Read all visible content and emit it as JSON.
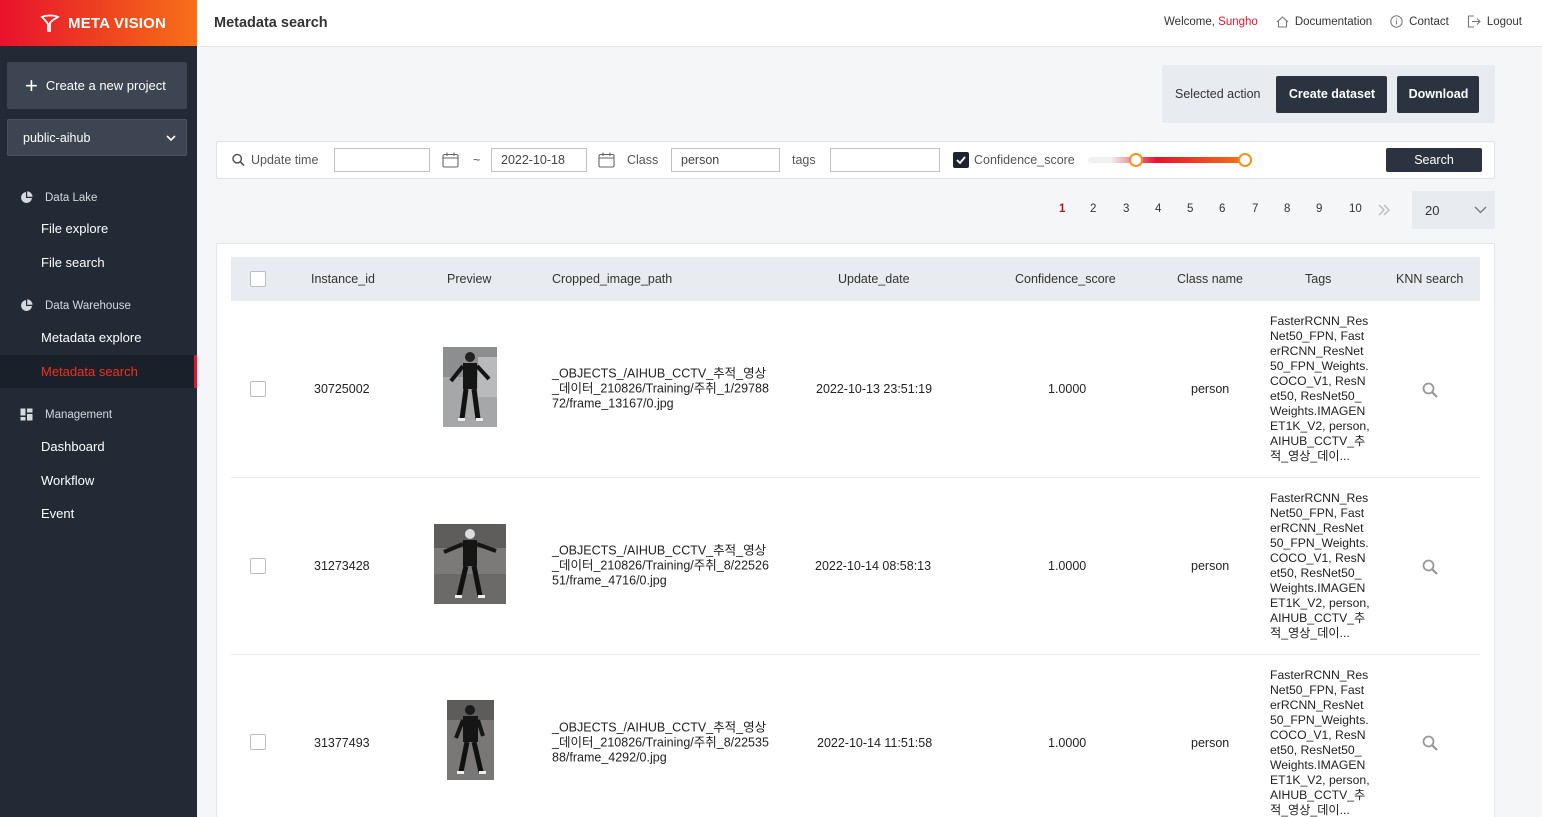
{
  "brand": {
    "name": "META VISION"
  },
  "sidebar": {
    "create_label": "Create a new project",
    "project_select": "public-aihub",
    "sections": [
      {
        "title": "Data Lake",
        "items": [
          "File explore",
          "File search"
        ]
      },
      {
        "title": "Data Warehouse",
        "items": [
          "Metadata explore",
          "Metadata search"
        ]
      },
      {
        "title": "Management",
        "items": [
          "Dashboard",
          "Workflow",
          "Event"
        ]
      }
    ],
    "active_item": "Metadata search"
  },
  "header": {
    "title": "Metadata search",
    "welcome": "Welcome,",
    "user": "Sungho",
    "links": [
      "Documentation",
      "Contact",
      "Logout"
    ]
  },
  "actions": {
    "label": "Selected action",
    "create_dataset": "Create dataset",
    "download": "Download"
  },
  "filters": {
    "update_time_label": "Update time",
    "date_from": "",
    "separator": "~",
    "date_to": "2022-10-18",
    "class_label": "Class",
    "class_value": "person",
    "tags_label": "tags",
    "tags_value": "",
    "confidence_checked": true,
    "confidence_label": "Confidence_score",
    "search_label": "Search"
  },
  "pagination": {
    "pages": [
      "1",
      "2",
      "3",
      "4",
      "5",
      "6",
      "7",
      "8",
      "9",
      "10"
    ],
    "current": "1",
    "next_icon": "double-chevron-right",
    "page_size": "20"
  },
  "table": {
    "columns": [
      "Instance_id",
      "Preview",
      "Cropped_image_path",
      "Update_date",
      "Confidence_score",
      "Class name",
      "Tags",
      "KNN search"
    ],
    "rows": [
      {
        "instance_id": "30725002",
        "path": "_OBJECTS_/AIHUB_CCTV_추적_영상_데이터_210826/Training/주취_1/2978872/frame_13167/0.jpg",
        "update_date": "2022-10-13 23:51:19",
        "confidence": "1.0000",
        "class_name": "person",
        "tags": "FasterRCNN_ResNet50_FPN, FasterRCNN_ResNet50_FPN_Weights.COCO_V1, ResNet50, ResNet50_Weights.IMAGENET1K_V2, person, AIHUB_CCTV_추적_영상_데이..."
      },
      {
        "instance_id": "31273428",
        "path": "_OBJECTS_/AIHUB_CCTV_추적_영상_데이터_210826/Training/주취_8/2252651/frame_4716/0.jpg",
        "update_date": "2022-10-14 08:58:13",
        "confidence": "1.0000",
        "class_name": "person",
        "tags": "FasterRCNN_ResNet50_FPN, FasterRCNN_ResNet50_FPN_Weights.COCO_V1, ResNet50, ResNet50_Weights.IMAGENET1K_V2, person, AIHUB_CCTV_추적_영상_데이..."
      },
      {
        "instance_id": "31377493",
        "path": "_OBJECTS_/AIHUB_CCTV_추적_영상_데이터_210826/Training/주취_8/2253588/frame_4292/0.jpg",
        "update_date": "2022-10-14 11:51:58",
        "confidence": "1.0000",
        "class_name": "person",
        "tags": "FasterRCNN_ResNet50_FPN, FasterRCNN_ResNet50_FPN_Weights.COCO_V1, ResNet50, ResNet50_Weights.IMAGENET1K_V2, person, AIHUB_CCTV_추적_영상_데이..."
      }
    ]
  },
  "colors": {
    "accent": "#e8112d",
    "sidebar": "#222a36",
    "button": "#2c3340"
  }
}
